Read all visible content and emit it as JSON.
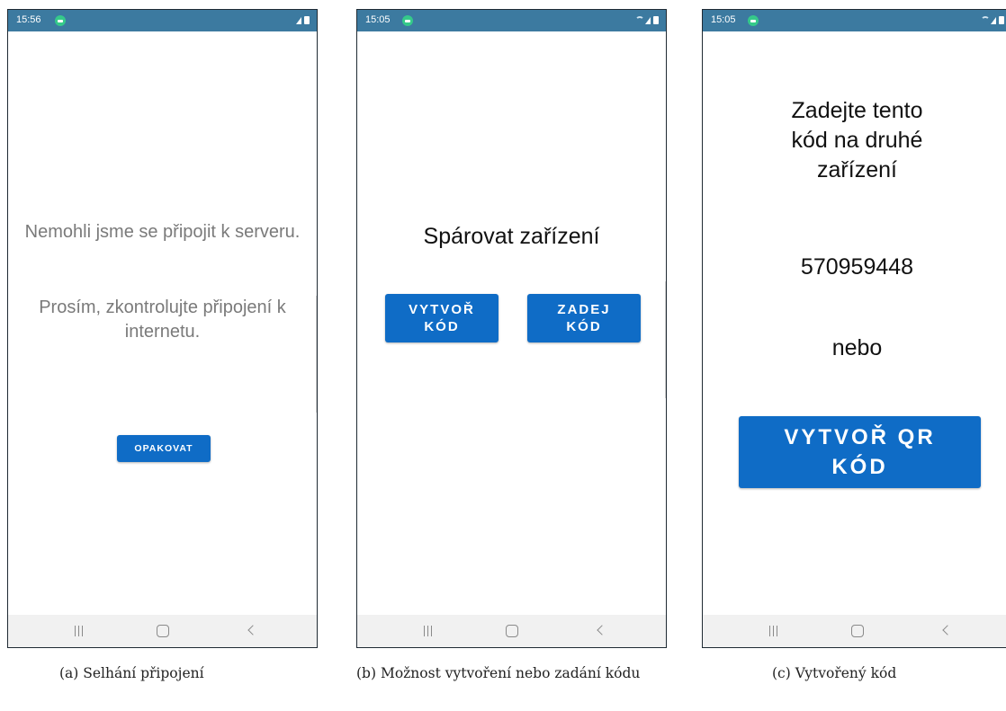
{
  "screens": [
    {
      "status_time": "15:56",
      "message_1": "Nemohli jsme se připojit k serveru.",
      "message_2": "Prosím, zkontrolujte připojení k internetu.",
      "retry_button": "OPAKOVAT",
      "caption": "(a) Selhání připojení"
    },
    {
      "status_time": "15:05",
      "title": "Spárovat zařízení",
      "create_code_button": "VYTVOŘ KÓD",
      "enter_code_button": "ZADEJ KÓD",
      "caption": "(b) Možnost vytvoření nebo zadání kódu"
    },
    {
      "status_time": "15:05",
      "instruction": "Zadejte tento kód na druhé zařízení",
      "code": "570959448",
      "or_text": "nebo",
      "create_qr_button": "VYTVOŘ QR KÓD",
      "caption": "(c) Vytvořený kód"
    }
  ],
  "colors": {
    "status_bar": "#3c7aa0",
    "button": "#0f6cc6",
    "nav_bar": "#f1f1f1"
  },
  "icons": [
    "android-notification-icon",
    "wifi-icon",
    "signal-icon",
    "battery-icon",
    "recent-apps-icon",
    "home-icon",
    "back-icon"
  ]
}
